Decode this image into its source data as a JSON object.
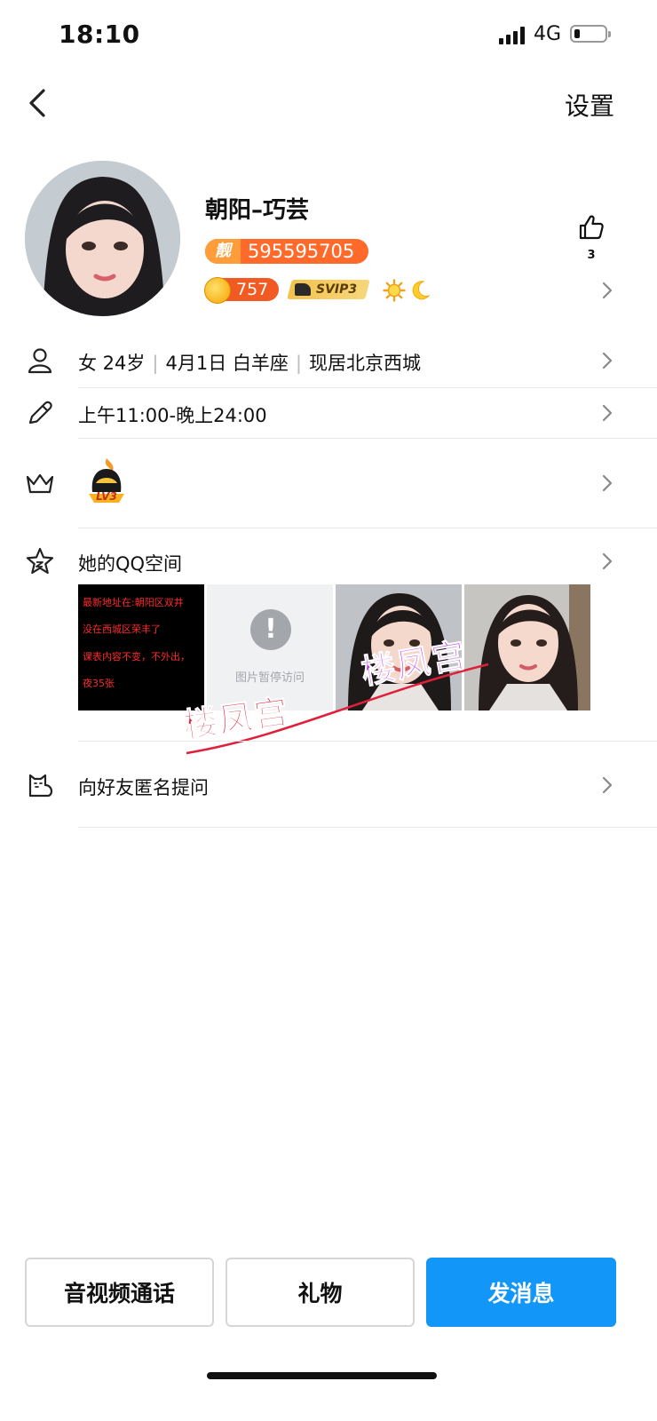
{
  "status_bar": {
    "time": "18:10",
    "network": "4G",
    "battery_level": 0.2
  },
  "nav": {
    "back_icon": "chevron-left-icon",
    "settings_label": "设置"
  },
  "profile": {
    "nickname": "朝阳–巧芸",
    "pretty_badge_mark": "靓",
    "qq_number": "595595705",
    "gold_count": "757",
    "svip_label": "SVIP3",
    "like_count": "3"
  },
  "info": {
    "gender_age": "女 24岁",
    "birthday_sign": "4月1日 白羊座",
    "location": "现居北京西城",
    "schedule": "上午11:00-晚上24:00",
    "level_badge": "LV3"
  },
  "qzone": {
    "title": "她的QQ空间",
    "thumb1_lines": [
      "最新地址在:朝阳区双井",
      "没在西城区荣丰了",
      "课表内容不变，不外出，",
      "夜35张"
    ],
    "thumb2_caption": "图片暂停访问",
    "watermark": "楼凤宫"
  },
  "ask": {
    "label": "向好友匿名提问"
  },
  "actions": {
    "call_label": "音视频通话",
    "gift_label": "礼物",
    "message_label": "发消息"
  },
  "colors": {
    "primary": "#1296f7",
    "pretty_badge": "#ff6a2b",
    "gold_badge": "#f15a22",
    "watermark_red": "#e0203a",
    "watermark_purple": "#c22ff0"
  }
}
